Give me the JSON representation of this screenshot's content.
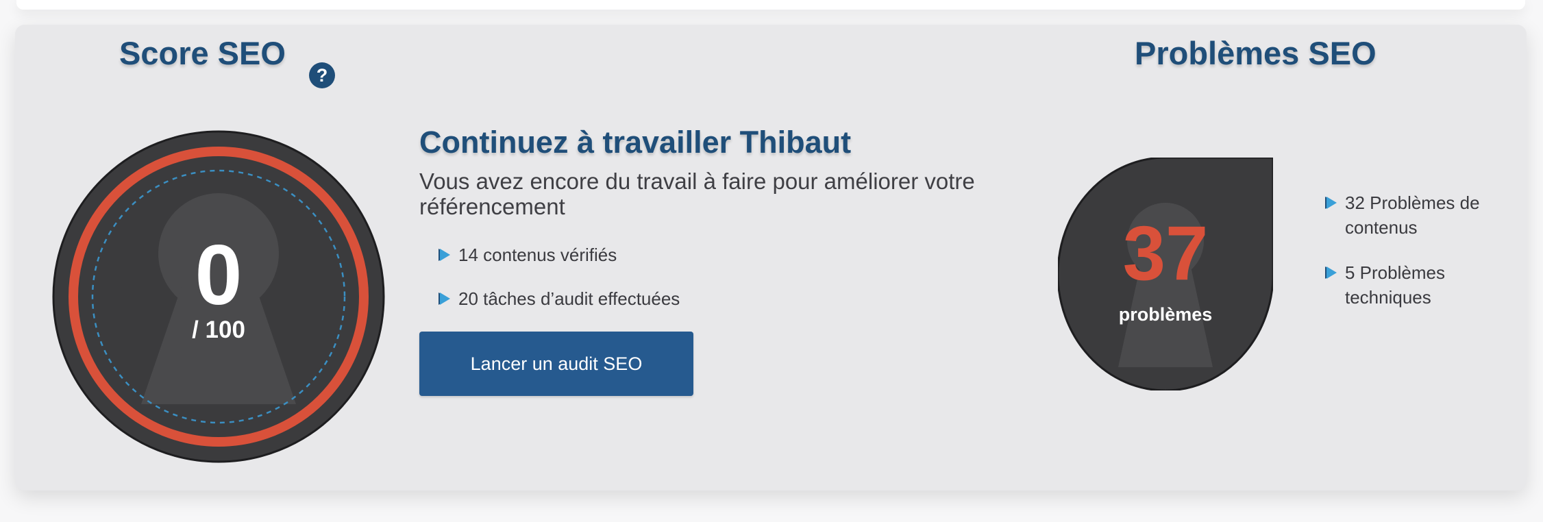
{
  "score_section": {
    "title": "Score SEO",
    "help_icon": "?",
    "value": "0",
    "max_label": "/ 100",
    "score_fraction": 0,
    "ring_color": "#d9513a"
  },
  "message_section": {
    "subtitle": "Continuez à travailler Thibaut",
    "message": "Vous avez encore du travail à faire pour améliorer votre référencement",
    "bullets": [
      "14 contenus vérifiés",
      "20 tâches d’audit effectuées"
    ],
    "button_label": "Lancer un audit SEO"
  },
  "problems_section": {
    "title": "Problèmes SEO",
    "count": "37",
    "count_label": "problèmes",
    "bullets": [
      "32 Problèmes de contenus",
      "5 Problèmes techniques"
    ]
  },
  "colors": {
    "heading": "#1f4e79",
    "accent_red": "#d9513a",
    "button": "#265a8f",
    "dark_circle": "#3b3b3d",
    "arrow": "#3aa0d8"
  },
  "icons": {
    "help": "question-circle-icon",
    "bullet": "triangle-arrow-icon",
    "gauge_background": "keyhole-icon"
  }
}
